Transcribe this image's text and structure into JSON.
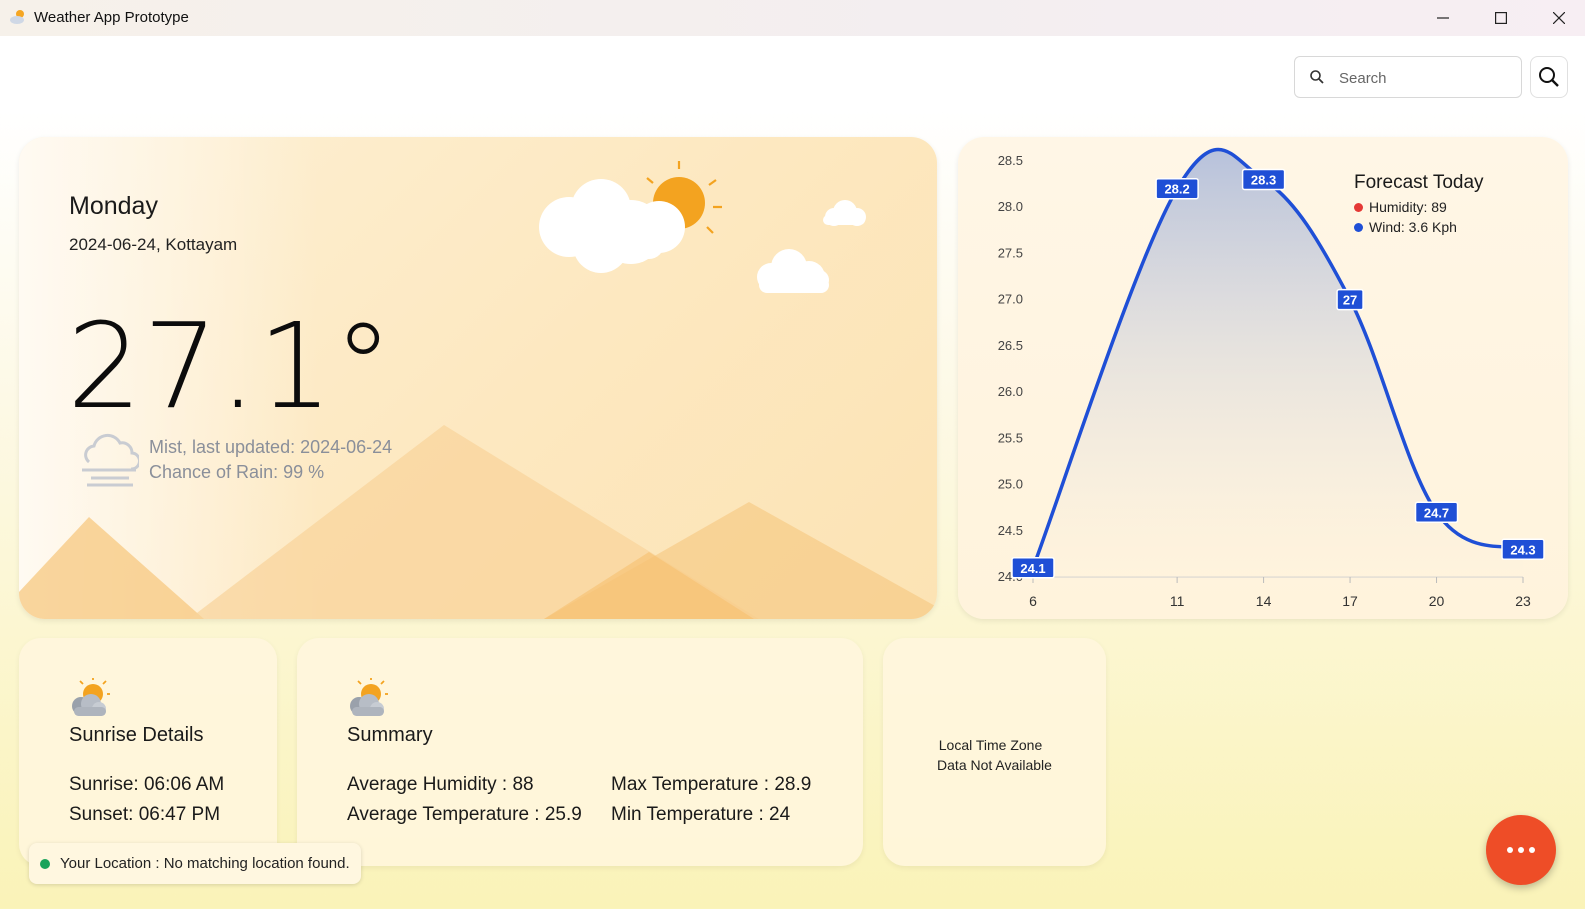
{
  "window": {
    "title": "Weather App Prototype",
    "minimize_icon": "minimize-icon",
    "maximize_icon": "maximize-icon",
    "close_icon": "close-icon"
  },
  "search": {
    "placeholder": "Search",
    "icon": "search-icon"
  },
  "current": {
    "day": "Monday",
    "date_location": "2024-06-24, Kottayam",
    "temperature": "27.1°",
    "condition": "Mist, last updated: 2024-06-24",
    "rain": "Chance of Rain: 99 %",
    "condition_icon": "mist-icon"
  },
  "forecast": {
    "title": "Forecast Today",
    "legend": [
      {
        "label": "Humidity: 89",
        "color": "#e53935"
      },
      {
        "label": "Wind: 3.6 Kph",
        "color": "#1f4fd6"
      }
    ]
  },
  "chart_data": {
    "type": "area",
    "title": "Forecast Today",
    "x": [
      6,
      11,
      14,
      17,
      20,
      23
    ],
    "xticks": [
      "6",
      "11",
      "14",
      "17",
      "20",
      "23"
    ],
    "yticks": [
      "24.0",
      "24.5",
      "25.0",
      "25.5",
      "26.0",
      "26.5",
      "27.0",
      "27.5",
      "28.0",
      "28.5"
    ],
    "ylim": [
      24.0,
      28.5
    ],
    "series": [
      {
        "values": [
          24.1,
          28.2,
          28.3,
          27,
          24.7,
          24.3
        ],
        "labels": [
          "24.1",
          "28.2",
          "28.3",
          "27",
          "24.7",
          "24.3"
        ],
        "color": "#1f4fd6"
      }
    ],
    "legend_position": "top-right",
    "grid": false
  },
  "sunrise": {
    "title": "Sunrise Details",
    "sunrise": "Sunrise: 06:06 AM",
    "sunset": "Sunset: 06:47 PM",
    "icon": "partly-cloudy-icon"
  },
  "summary": {
    "title": "Summary",
    "avg_humidity": "Average Humidity : 88",
    "avg_temperature": "Average Temperature : 25.9",
    "max_temperature": "Max Temperature : 28.9",
    "min_temperature": "Min Temperature : 24",
    "icon": "partly-cloudy-icon"
  },
  "timezone": {
    "line1": "Local Time Zone",
    "line2": "Data Not Available"
  },
  "toast": {
    "text": "Your Location : No matching location found.",
    "status_color": "#1aa35a"
  },
  "fab": {
    "icon": "more-icon"
  }
}
